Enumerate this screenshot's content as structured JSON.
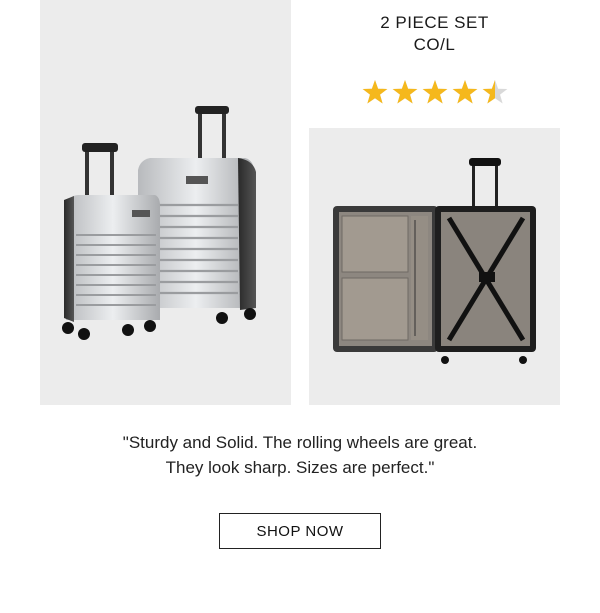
{
  "product": {
    "title_line1": "2 PIECE SET",
    "title_line2": "CO/L",
    "rating": 4.5,
    "rating_max": 5,
    "star_color": "#f5b81c",
    "star_empty_color": "#d9d9d9"
  },
  "review": {
    "line1": "\"Sturdy and Solid. The rolling wheels are great.",
    "line2": "They look sharp. Sizes are perfect.\""
  },
  "cta": {
    "label": "SHOP NOW"
  },
  "images": {
    "set_image": "luggage-set-image",
    "interior_image": "open-suitcase-image"
  }
}
